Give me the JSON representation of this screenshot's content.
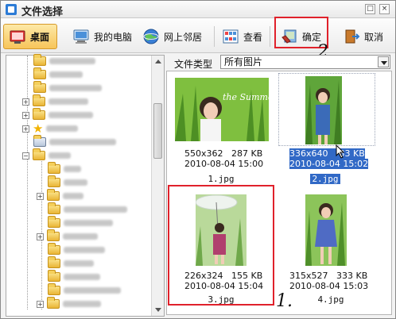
{
  "window": {
    "title": "文件选择",
    "controls": [
      "□",
      "×"
    ]
  },
  "toolbar": {
    "desktop_label": "桌面",
    "my_computer_label": "我的电脑",
    "network_label": "网上邻居",
    "view_label": "查看",
    "ok_label": "确定",
    "cancel_label": "取消"
  },
  "tree": {
    "star_glyph": "★",
    "expand_glyph": "+",
    "collapse_glyph": "−"
  },
  "filter": {
    "label": "文件类型",
    "value": "所有图片"
  },
  "files": [
    {
      "dims": "550x362",
      "size": "287 KB",
      "date": "2010-08-04 15:00",
      "name": "1.jpg",
      "selected": false
    },
    {
      "dims": "336x640",
      "size": "33 KB",
      "date": "2010-08-04 15:02",
      "name": "2.jpg",
      "selected": true
    },
    {
      "dims": "226x324",
      "size": "155 KB",
      "date": "2010-08-04 15:04",
      "name": "3.jpg",
      "selected": false
    },
    {
      "dims": "315x527",
      "size": "333 KB",
      "date": "2010-08-04 15:03",
      "name": "4.jpg",
      "selected": false
    }
  ],
  "photo1_caption": "the Summer story",
  "annotations": {
    "step1": "1.",
    "step2": "2."
  },
  "colors": {
    "selection": "#3169c6",
    "annotation_red": "#e0212b",
    "active_tool": "#f7c55a"
  }
}
